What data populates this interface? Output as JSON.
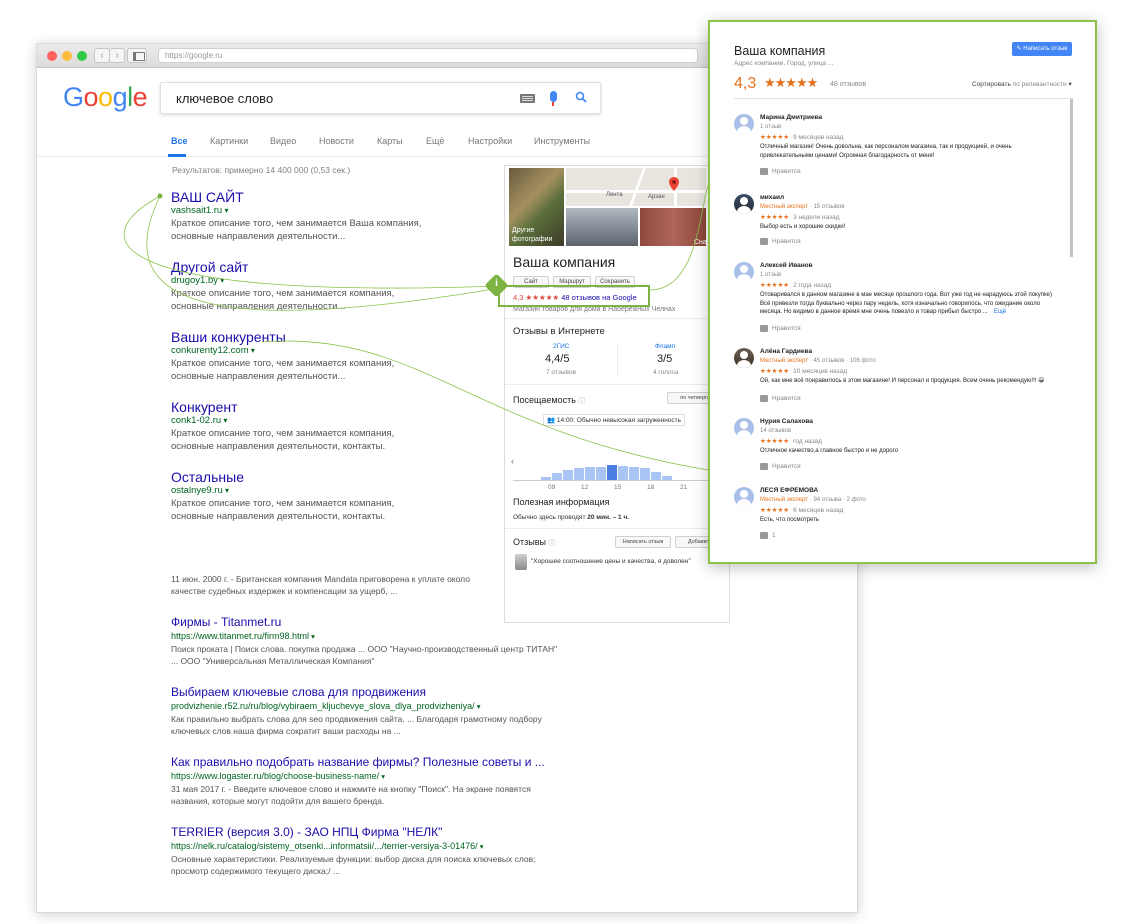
{
  "browser": {
    "url": "https://google.ru"
  },
  "google": {
    "logo": [
      "G",
      "o",
      "o",
      "g",
      "l",
      "e"
    ],
    "query": "ключевое слово",
    "tabs": [
      "Все",
      "Картинки",
      "Видео",
      "Новости",
      "Карты",
      "Ещё",
      "Настройки",
      "Инструменты"
    ],
    "stats": "Результатов: примерно 14 400 000 (0,53 сек.)"
  },
  "results": [
    {
      "title": "ВАШ САЙТ",
      "url": "vashsait1.ru",
      "desc": [
        "Краткое описание того, чем занимается Ваша компания,",
        "основные направления деятельности..."
      ]
    },
    {
      "title": "Другой сайт",
      "url": "drugoy1.by",
      "desc": [
        "Краткое описание того, чем занимается компания,",
        "основные направления деятельности..."
      ]
    },
    {
      "title": "Ваши конкуренты",
      "url": "conkurenty12.com",
      "desc": [
        "Краткое описание того, чем занимается компания,",
        "основные направления деятельности..."
      ]
    },
    {
      "title": "Конкурент",
      "url": "conk1-02.ru",
      "desc": [
        "Краткое описание того, чем занимается компания,",
        "основные направления деятельности, контакты."
      ]
    },
    {
      "title": "Остальные",
      "url": "ostalnye9.ru",
      "desc": [
        "Краткое описание того, чем занимается компания,",
        "основные направления деятельности, контакты."
      ]
    }
  ],
  "results2": {
    "fragment": [
      "11 июн. 2000 г. - Британская компания Mandata приговорена к уплате около",
      "качестве судебных издержек и компенсации за ущерб, ..."
    ],
    "items": [
      {
        "title": "Фирмы - Titanmet.ru",
        "url": "https://www.titanmet.ru/firm98.html",
        "desc": [
          "Поиск проката | Поиск слова. покупка продажа ... ООО \"Научно-производственный центр ТИТАН\"",
          "... ООО \"Универсальная Металлическая Компания\""
        ]
      },
      {
        "title": "Выбираем ключевые слова для продвижения",
        "url": "prodvizhenie.r52.ru/ru/blog/vybiraem_kljuchevye_slova_dlya_prodvizheniya/",
        "desc": [
          "Как правильно выбрать слова для seo продвижения сайта. ... Благодаря грамотному подбору",
          "ключевых слов наша фирма сократит ваши расходы на ..."
        ]
      },
      {
        "title": "Как правильно подобрать название фирмы? Полезные советы и ...",
        "url": "https://www.logaster.ru/blog/choose-business-name/",
        "desc": [
          "31 мая 2017 г. - Введите ключевое слово и нажмите на кнопку \"Поиск\". На экране появятся",
          "названия, которые могут подойти для вашего бренда."
        ]
      },
      {
        "title": "TERRIER (версия 3.0) - ЗАО НПЦ Фирма \"НЕЛК\"",
        "url": "https://nelk.ru/catalog/sistemy_otsenki...informatsii/.../terrier-versiya-3-01476/",
        "desc": [
          "Основные характеристики. Реализуемые функции: выбор диска для поиска ключевых слов;",
          "просмотр содержимого текущего диска;/ ..."
        ]
      }
    ]
  },
  "knowledge_panel": {
    "photo_other": [
      "Другие",
      "фотографии"
    ],
    "photo_street": "Сна",
    "map_labels": [
      "Лента",
      "Арзан"
    ],
    "title": "Ваша компания",
    "buttons": [
      "Сайт",
      "Маршрут",
      "Сохранить"
    ],
    "rating": "4,3",
    "stars": "★★★★★",
    "reviews_link": "48 отзывов на Google",
    "category": "Магазин товаров для дома в Набережных Челнах",
    "online_reviews_title": "Отзывы в Интернете",
    "sources": [
      {
        "name": "2ГИС",
        "score": "4,4/5",
        "count": "7 отзывов"
      },
      {
        "name": "Фламп",
        "score": "3/5",
        "count": "4 голоса"
      }
    ],
    "traffic_title": "Посещаемость",
    "traffic_day": "по четвергам",
    "traffic_now": "14:00: Обычно невысокая загруженность",
    "traffic_hours": [
      "09",
      "12",
      "15",
      "18",
      "21"
    ],
    "traffic_values": [
      0.15,
      0.3,
      0.45,
      0.55,
      0.6,
      0.6,
      0.7,
      0.65,
      0.6,
      0.55,
      0.35,
      0.2
    ],
    "useful_title": "Полезная информация",
    "useful_text_prefix": "Обычно здесь проводят",
    "useful_text_bold": "20 мин. – 1 ч.",
    "reviews_title": "Отзывы",
    "write_review": "Написать отзыв",
    "add_photo": "Добавить ф",
    "quote": "\"Хорошее соотношение цены и качества, я доволен\""
  },
  "popup": {
    "title": "Ваша компания",
    "address": "Адрес компании, Город, улица ...",
    "write_review": "Написать отзыв",
    "rating": "4,3",
    "stars": "★★★★★",
    "count": "48 отзывов",
    "sort_label": "Сортировать",
    "sort_value": "по релевантности",
    "reviews": [
      {
        "name": "Марина Дмитриева",
        "meta": "1 отзыв",
        "expert": "",
        "stars": "★★★★★",
        "when": "9 месяцев назад",
        "text": "Отличный магазин! Очень довольна, как персоналом магазина, так и продукцией, и очень привлекательными ценами! Огромная благодарность от меня!",
        "more": "",
        "like": "Нравится"
      },
      {
        "name": "михаил",
        "meta": "15 отзывов",
        "expert": "Местный эксперт",
        "stars": "★★★★★",
        "when": "3 недели назад",
        "text": "Выбор есть и хорошие скидки!",
        "more": "",
        "like": "Нравится"
      },
      {
        "name": "Алексей Иванов",
        "meta": "1 отзыв",
        "expert": "",
        "stars": "★★★★★",
        "when": "2 года назад",
        "text": "Отоваривался в данном магазине в мае месяце прошлого года. Вот уже год не нарадуюсь этой покупке) Всё привезли тогда буквально через пару недель, хотя изначально говорилось, что ожидание около месяца. Но видимо в данное время мне очень повезло и товар прибыл быстро ...",
        "more": "Ещё",
        "like": "Нравится"
      },
      {
        "name": "Алёна Гардиева",
        "meta": "45 отзывов · 106 фото",
        "expert": "Местный эксперт",
        "stars": "★★★★★",
        "when": "10 месяцев назад",
        "text": "Ой, как мне всё понравилось в этом магазине! И персонал и продукция. Всем очень рекомендую!!! 😀",
        "more": "",
        "like": "Нравится"
      },
      {
        "name": "Нурия Салахова",
        "meta": "14 отзывов",
        "expert": "",
        "stars": "★★★★★",
        "when": "год назад",
        "text": "Отличное качество,а главное быстро и не дорого",
        "more": "",
        "like": "Нравится"
      },
      {
        "name": "ЛЕСЯ ЕФРЕМОВА",
        "meta": "94 отзыва · 2 фото",
        "expert": "Местный эксперт",
        "stars": "★★★★★",
        "when": "6 месяцев назад",
        "text": "Есть, что посмотреть",
        "more": "",
        "like": "1"
      }
    ]
  },
  "colors": {
    "accent": "#1a73e8",
    "link": "#1a0dab",
    "url": "#006621",
    "highlight": "#7cb342",
    "star": "#e7711b"
  }
}
